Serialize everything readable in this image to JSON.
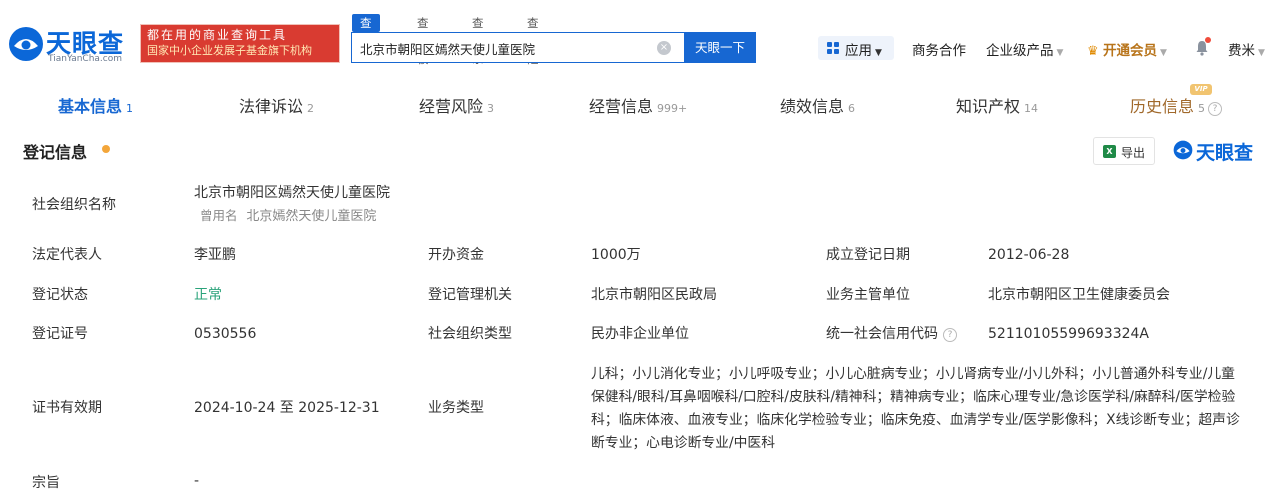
{
  "header": {
    "logo_text": "天眼查",
    "logo_sub": "TianYanCha.com",
    "promo_line1": "都在用的商业查询工具",
    "promo_line2": "国家中小企业发展子基金旗下机构",
    "search_tabs": [
      "查公司",
      "查老板",
      "查关系",
      "查风险"
    ],
    "search_value": "北京市朝阳区嫣然天使儿童医院",
    "search_button": "天眼一下",
    "nav": {
      "apps": "应用",
      "business": "商务合作",
      "enterprise": "企业级产品",
      "vip": "开通会员",
      "user": "费米"
    }
  },
  "tabs": [
    {
      "label": "基本信息",
      "count": "1"
    },
    {
      "label": "法律诉讼",
      "count": "2"
    },
    {
      "label": "经营风险",
      "count": "3"
    },
    {
      "label": "经营信息",
      "count": "999+"
    },
    {
      "label": "绩效信息",
      "count": "6"
    },
    {
      "label": "知识产权",
      "count": "14"
    },
    {
      "label": "历史信息",
      "count": "5"
    }
  ],
  "vip_tag": "VIP",
  "section": {
    "title": "登记信息",
    "export": "导出",
    "watermark": "天眼查"
  },
  "info": {
    "org_name_label": "社会组织名称",
    "org_name": "北京市朝阳区嫣然天使儿童医院",
    "former_name_tag": "曾用名",
    "former_name": "北京嫣然天使儿童医院",
    "legal_rep_label": "法定代表人",
    "legal_rep": "李亚鹏",
    "capital_label": "开办资金",
    "capital": "1000万",
    "reg_date_label": "成立登记日期",
    "reg_date": "2012-06-28",
    "status_label": "登记状态",
    "status": "正常",
    "authority_label": "登记管理机关",
    "authority": "北京市朝阳区民政局",
    "supervisor_label": "业务主管单位",
    "supervisor": "北京市朝阳区卫生健康委员会",
    "cert_no_label": "登记证号",
    "cert_no": "0530556",
    "org_type_label": "社会组织类型",
    "org_type": "民办非企业单位",
    "credit_code_label": "统一社会信用代码",
    "credit_code": "52110105599693324A",
    "validity_label": "证书有效期",
    "validity": "2024-10-24 至 2025-12-31",
    "business_type_label": "业务类型",
    "business_type": "儿科；小儿消化专业；小儿呼吸专业；小儿心脏病专业；小儿肾病专业/小儿外科；小儿普通外科专业/儿童保健科/眼科/耳鼻咽喉科/口腔科/皮肤科/精神科；精神病专业；临床心理专业/急诊医学科/麻醉科/医学检验科；临床体液、血液专业；临床化学检验专业；临床免疫、血清学专业/医学影像科；X线诊断专业；超声诊断专业；心电诊断专业/中医科",
    "purpose_label": "宗旨",
    "purpose": "-"
  }
}
